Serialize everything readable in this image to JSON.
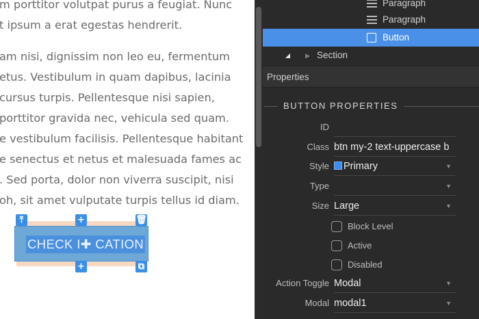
{
  "canvas": {
    "paragraph_1": [
      "m porttitor volutpat purus a feugiat. Nunc",
      "t ipsum a erat egestas hendrerit."
    ],
    "paragraph_2": [
      "am nisi, dignissim non leo eu, fermentum",
      "etus. Vestibulum in quam dapibus, lacinia",
      "cursus turpis. Pellentesque nisi sapien,",
      "porttitor gravida nec, vehicula sed quam.",
      "e vestibulum facilisis. Pellentesque habitant",
      "e senectus et netus et malesuada fames ac",
      ". Sed porta, dolor non viverra suscipit, nisi",
      "oh, sit amet vulputate turpis tellus id diam."
    ],
    "selected_button": {
      "text": "CHECK I✚ CATION",
      "handles": {
        "top_left": "⤒",
        "top_mid": "+",
        "top_right": "🗑",
        "center": "✚",
        "bottom_mid": "+",
        "bottom_right": "⧉"
      }
    }
  },
  "tree": {
    "items": [
      {
        "label": "Paragraph",
        "icon": "paragraph-icon"
      },
      {
        "label": "Paragraph",
        "icon": "paragraph-icon"
      },
      {
        "label": "Button",
        "icon": "button-icon",
        "selected": true
      },
      {
        "label": "Section",
        "icon": "section-icon",
        "toggle": "collapse-triangle-icon"
      }
    ]
  },
  "properties": {
    "header": "Properties",
    "section_title": "BUTTON PROPERTIES",
    "fields": {
      "id": {
        "label": "ID",
        "value": ""
      },
      "class": {
        "label": "Class",
        "value": "btn my-2 text-uppercase b"
      },
      "style": {
        "label": "Style",
        "value": "Primary",
        "swatch": "#3d8bf0"
      },
      "type": {
        "label": "Type",
        "value": ""
      },
      "size": {
        "label": "Size",
        "value": "Large"
      },
      "action_toggle": {
        "label": "Action Toggle",
        "value": "Modal"
      },
      "modal": {
        "label": "Modal",
        "value": "modal1"
      }
    },
    "checkboxes": {
      "block_level": {
        "label": "Block Level",
        "checked": false
      },
      "active": {
        "label": "Active",
        "checked": false
      },
      "disabled": {
        "label": "Disabled",
        "checked": false
      }
    },
    "caret": "▼"
  },
  "colors": {
    "panel_bg": "#2a2a2a",
    "selection_blue": "#4a90e8",
    "button_fill": "#6ea8d7",
    "handle_blue": "#3b8ee6"
  }
}
